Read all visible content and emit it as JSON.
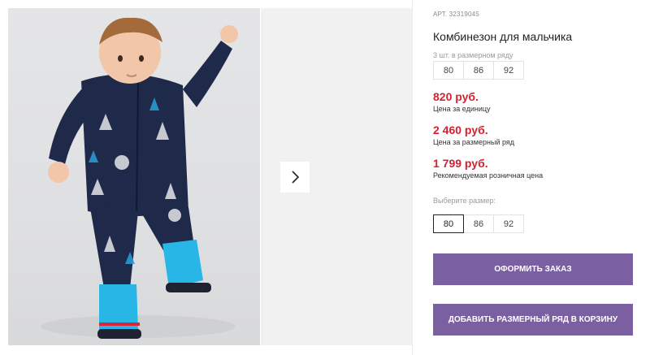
{
  "product": {
    "article": "АРТ. 32319045",
    "title": "Комбинезон для мальчика",
    "pack_note": "3 шт. в размерном ряду",
    "pack_sizes": [
      "80",
      "86",
      "92"
    ],
    "prices": [
      {
        "amount": "820 руб.",
        "caption": "Цена за единицу"
      },
      {
        "amount": "2 460 руб.",
        "caption": "Цена за размерный ряд"
      },
      {
        "amount": "1 799 руб.",
        "caption": "Рекомендуемая розничная цена"
      }
    ],
    "choose_size_label": "Выберите размер:",
    "size_options": [
      "80",
      "86",
      "92"
    ],
    "selected_size": "80"
  },
  "actions": {
    "order_label": "ОФОРМИТЬ ЗАКАЗ",
    "add_row_label": "ДОБАВИТЬ РАЗМЕРНЫЙ РЯД В КОРЗИНУ"
  },
  "gallery": {
    "next_icon": "chevron-right-icon"
  },
  "colors": {
    "price": "#d6202f",
    "button": "#7a5fa1",
    "jumpsuit": "#1f2a4a",
    "boots": "#27b6e6"
  }
}
